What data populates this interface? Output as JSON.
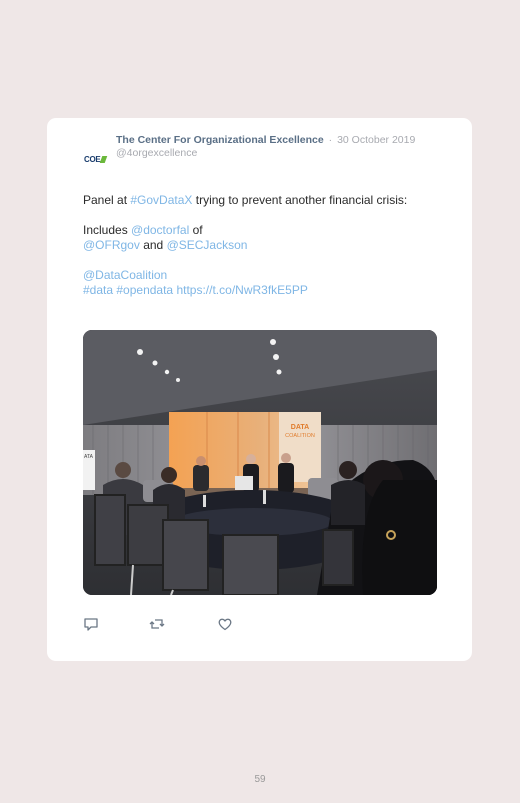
{
  "tweet": {
    "author": "The Center For Organizational Excellence",
    "separator": "·",
    "date": "30 October 2019",
    "handle": "@4orgexcellence",
    "avatar_text": "COE",
    "line1_text": "Panel at ",
    "line1_hashtag": "#GovDataX",
    "line1_rest": " trying to prevent another financial crisis:",
    "line2_text": "Includes ",
    "line2_mention": "@doctorfal",
    "line2_of": " of",
    "line3_mention1": "@OFRgov",
    "line3_and": " and ",
    "line3_mention2": "@SECJackson",
    "line4_mention": "@DataCoalition",
    "line5_hashtag1": "#data",
    "line5_hashtag2": "#opendata",
    "line5_url": "https://t.co/NwR3fkE5PP"
  },
  "media": {
    "backdrop_text_1": "DATA",
    "backdrop_text_2": "COALITION",
    "stand_text": "ATA"
  },
  "actions": {
    "reply_icon": "reply-icon",
    "retweet_icon": "retweet-icon",
    "like_icon": "heart-icon"
  },
  "page": {
    "number": "59"
  },
  "colors": {
    "background": "#efe7e7",
    "card": "#ffffff",
    "link": "#7fb6e5",
    "author": "#5a6f86",
    "muted": "#a8aab0",
    "brand_green": "#6bb83b",
    "brand_blue": "#1a3d6d"
  }
}
